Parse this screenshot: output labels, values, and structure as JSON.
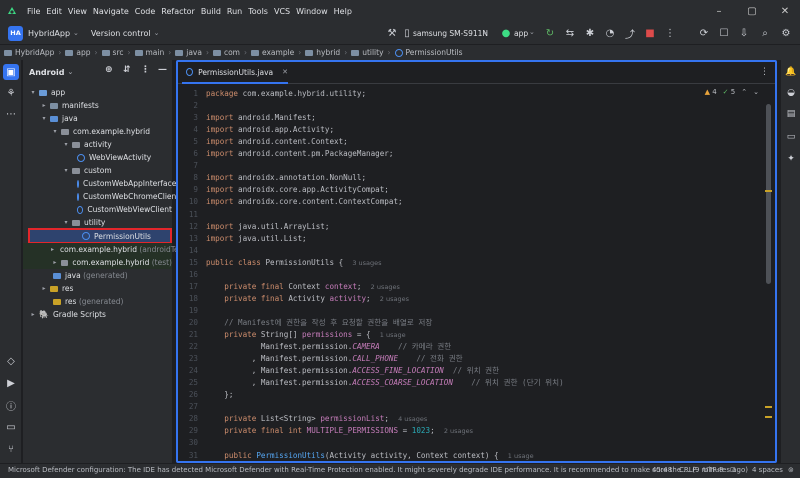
{
  "menubar": {
    "items": [
      "File",
      "Edit",
      "View",
      "Navigate",
      "Code",
      "Refactor",
      "Build",
      "Run",
      "Tools",
      "VCS",
      "Window",
      "Help"
    ]
  },
  "toolbar": {
    "project_badge": "HA",
    "project_name": "HybridApp",
    "vcs_label": "Version control",
    "device": "samsung SM-S911N",
    "run_config": "app"
  },
  "breadcrumbs": [
    "HybridApp",
    "app",
    "src",
    "main",
    "java",
    "com",
    "example",
    "hybrid",
    "utility",
    "PermissionUtils"
  ],
  "project_panel": {
    "view_mode": "Android",
    "tree": [
      {
        "label": "app",
        "icon": "module-folder-icon",
        "arrow": "down"
      },
      {
        "label": "manifests",
        "icon": "folder-icon",
        "arrow": "right"
      },
      {
        "label": "java",
        "icon": "source-folder-icon",
        "arrow": "down"
      },
      {
        "label": "com.example.hybrid",
        "icon": "package-icon",
        "arrow": "down"
      },
      {
        "label": "activity",
        "icon": "package-icon",
        "arrow": "down"
      },
      {
        "label": "WebViewActivity",
        "icon": "class-icon",
        "arrow": ""
      },
      {
        "label": "custom",
        "icon": "package-icon",
        "arrow": "down"
      },
      {
        "label": "CustomWebAppInterface",
        "icon": "class-icon",
        "arrow": ""
      },
      {
        "label": "CustomWebChromeClient",
        "icon": "class-icon",
        "arrow": ""
      },
      {
        "label": "CustomWebViewClient",
        "icon": "class-icon",
        "arrow": ""
      },
      {
        "label": "utility",
        "icon": "package-icon",
        "arrow": "down"
      },
      {
        "label": "PermissionUtils",
        "icon": "class-icon",
        "arrow": ""
      },
      {
        "label": "com.example.hybrid",
        "suffix": "(androidTest)",
        "icon": "package-icon",
        "arrow": "right"
      },
      {
        "label": "com.example.hybrid",
        "suffix": "(test)",
        "icon": "package-icon",
        "arrow": "right"
      },
      {
        "label": "java",
        "suffix": "(generated)",
        "icon": "generated-folder-icon",
        "arrow": ""
      },
      {
        "label": "res",
        "icon": "res-folder-icon",
        "arrow": "right"
      },
      {
        "label": "res",
        "suffix": "(generated)",
        "icon": "res-folder-icon",
        "arrow": ""
      },
      {
        "label": "Gradle Scripts",
        "icon": "gradle-icon",
        "arrow": "right"
      }
    ]
  },
  "editor": {
    "tab_label": "PermissionUtils.java",
    "warnings": "4",
    "checks": "5",
    "lines": [
      {
        "n": "1",
        "t": "package com.example.hybrid.utility;"
      },
      {
        "n": "2",
        "t": ""
      },
      {
        "n": "3",
        "t": "import android.Manifest;"
      },
      {
        "n": "4",
        "t": "import android.app.Activity;"
      },
      {
        "n": "5",
        "t": "import android.content.Context;"
      },
      {
        "n": "6",
        "t": "import android.content.pm.PackageManager;"
      },
      {
        "n": "7",
        "t": ""
      },
      {
        "n": "8",
        "t": "import androidx.annotation.NonNull;"
      },
      {
        "n": "9",
        "t": "import androidx.core.app.ActivityCompat;"
      },
      {
        "n": "10",
        "t": "import androidx.core.content.ContextCompat;"
      },
      {
        "n": "11",
        "t": ""
      },
      {
        "n": "12",
        "t": "import java.util.ArrayList;"
      },
      {
        "n": "13",
        "t": "import java.util.List;"
      },
      {
        "n": "14",
        "t": ""
      },
      {
        "n": "15",
        "t": "public class PermissionUtils {"
      },
      {
        "n": "16",
        "t": ""
      },
      {
        "n": "17",
        "t": "    private final Context context;"
      },
      {
        "n": "18",
        "t": "    private final Activity activity;"
      },
      {
        "n": "19",
        "t": ""
      },
      {
        "n": "20",
        "t": "    // Manifest에 권한을 작성 후 요청할 권한을 배열로 저장"
      },
      {
        "n": "21",
        "t": "    private String[] permissions = {"
      },
      {
        "n": "22",
        "t": "            Manifest.permission.CAMERA    // 카메라 권한"
      },
      {
        "n": "23",
        "t": "          , Manifest.permission.CALL_PHONE    // 전화 권한"
      },
      {
        "n": "24",
        "t": "          , Manifest.permission.ACCESS_FINE_LOCATION  // 위치 권한"
      },
      {
        "n": "25",
        "t": "          , Manifest.permission.ACCESS_COARSE_LOCATION    // 위치 권한 (단기 위치)"
      },
      {
        "n": "26",
        "t": "    };"
      },
      {
        "n": "27",
        "t": ""
      },
      {
        "n": "28",
        "t": "    private List<String> permissionList;"
      },
      {
        "n": "29",
        "t": "    private final int MULTIPLE_PERMISSIONS = 1023;"
      },
      {
        "n": "30",
        "t": ""
      },
      {
        "n": "31",
        "t": "    public PermissionUtils(Activity activity, Context context) {"
      }
    ],
    "hints": {
      "l15": "3 usages",
      "l17": "2 usages",
      "l18": "2 usages",
      "l21": "1 usage",
      "l28": "4 usages",
      "l29": "2 usages",
      "l31": "1 usage"
    }
  },
  "statusbar": {
    "message": "Microsoft Defender configuration: The IDE has detected Microsoft Defender with Real-Time Protection enabled. It might severely degrade IDE performance. It is recommended to make sure the ... (9 minutes ago)",
    "position": "45:48",
    "line_sep": "CRLF",
    "encoding": "UTF-8",
    "indent": "4 spaces"
  },
  "colors": {
    "accent": "#3574f0",
    "selection_outline": "#e3262b",
    "logo_green": "#3ddc84"
  }
}
